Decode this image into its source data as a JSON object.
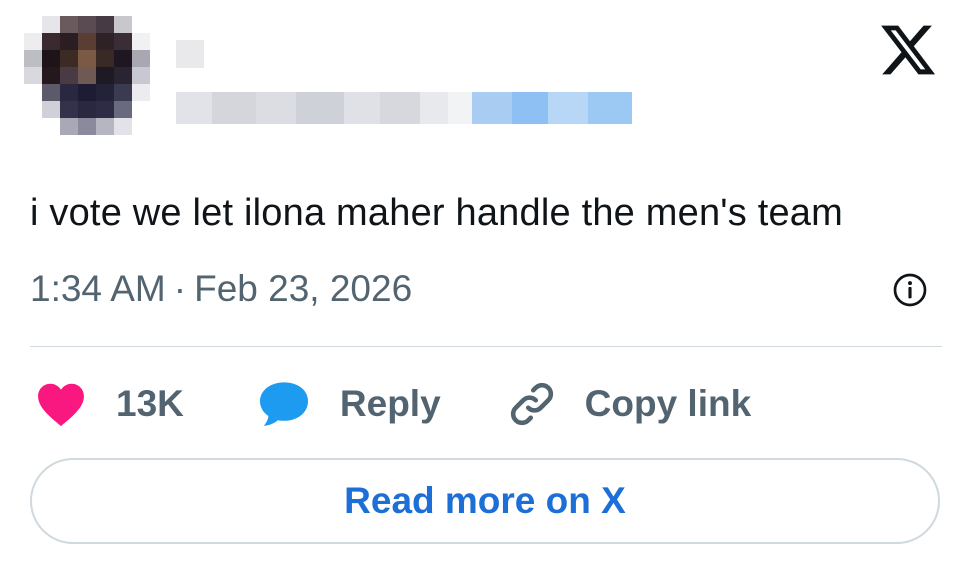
{
  "tweet": {
    "text": "i vote we let ilona maher handle the men's team",
    "time": "1:34 AM",
    "separator": "·",
    "date": "Feb 23, 2026"
  },
  "author": {
    "avatar_icon": "pixelated-avatar",
    "name_obscured": true,
    "handle_obscured": true
  },
  "brand": {
    "logo_icon": "x-logo-icon"
  },
  "actions": {
    "like_count": "13K",
    "like_icon": "heart-icon",
    "reply_label": "Reply",
    "reply_icon": "speech-bubble-icon",
    "copy_label": "Copy link",
    "copy_icon": "link-icon"
  },
  "read_more": {
    "label": "Read more on X"
  },
  "colors": {
    "text_primary": "#0f1419",
    "text_secondary": "#536471",
    "divider": "#cfd9de",
    "like_pink": "#f91880",
    "reply_blue": "#1d9bf0",
    "link_blue": "#1d6fd8"
  }
}
